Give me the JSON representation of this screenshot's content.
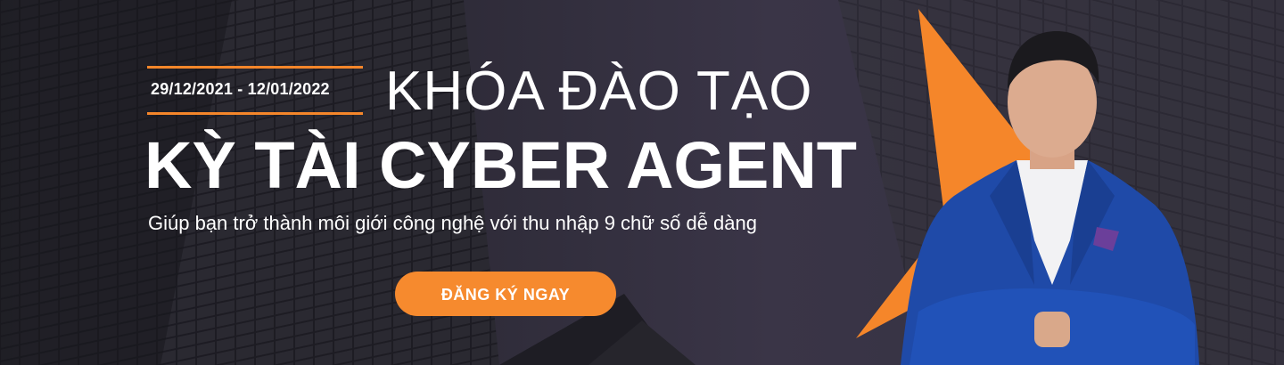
{
  "banner": {
    "date_range": "29/12/2021 - 12/01/2022",
    "title_line1": "KHÓA ĐÀO TẠO",
    "title_line2": "KỲ TÀI CYBER AGENT",
    "subtitle": "Giúp bạn trở thành môi giới công nghệ với thu nhập 9 chữ số dễ dàng",
    "cta_label": "ĐĂNG KÝ NGAY"
  },
  "colors": {
    "accent": "#f68a2e",
    "background": "#2e2b38",
    "text": "#ffffff"
  }
}
